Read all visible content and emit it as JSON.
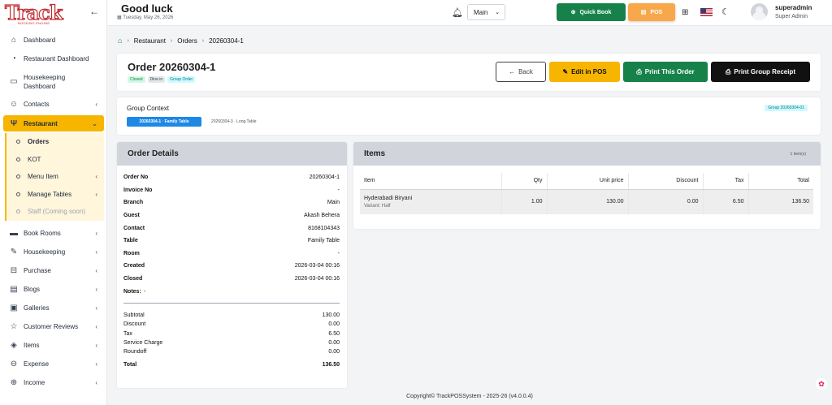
{
  "brand": {
    "name": "Track",
    "tagline": "BOOKING ENGINE"
  },
  "header": {
    "greeting": "Good luck",
    "date": "Tuesday, May 26, 2026",
    "branch": "Main",
    "quick_book": "Quick Book",
    "pos": "POS",
    "user_name": "superadmin",
    "user_role": "Super Admin"
  },
  "sidebar": {
    "items": [
      {
        "label": "Dashboard",
        "icon": "home-icon"
      },
      {
        "label": "Restaurant Dashboard",
        "icon": "dashboard-icon"
      },
      {
        "label": "Housekeeping Dashboard",
        "icon": "housekeeping-icon"
      },
      {
        "label": "Contacts",
        "icon": "contacts-icon"
      },
      {
        "label": "Restaurant",
        "icon": "fork-knife-icon"
      }
    ],
    "restaurant_sub": [
      {
        "label": "Orders"
      },
      {
        "label": "KOT"
      },
      {
        "label": "Menu Item"
      },
      {
        "label": "Manage Tables"
      },
      {
        "label": "Staff (Coming soon)"
      }
    ],
    "items_after": [
      {
        "label": "Book Rooms",
        "icon": "bed-icon"
      },
      {
        "label": "Housekeeping",
        "icon": "broom-icon"
      },
      {
        "label": "Purchase",
        "icon": "cart-icon"
      },
      {
        "label": "Blogs",
        "icon": "blog-icon"
      },
      {
        "label": "Galleries",
        "icon": "gallery-icon"
      },
      {
        "label": "Customer Reviews",
        "icon": "star-icon"
      },
      {
        "label": "Items",
        "icon": "box-icon"
      },
      {
        "label": "Expense",
        "icon": "minus-circle-icon"
      },
      {
        "label": "Income",
        "icon": "plus-circle-icon"
      }
    ]
  },
  "breadcrumb": {
    "items": [
      "Restaurant",
      "Orders",
      "20260304-1"
    ]
  },
  "order": {
    "title": "Order 20260304-1",
    "badges": {
      "status": "Closed",
      "type": "Dine in",
      "group": "Group Order"
    },
    "buttons": {
      "back": "Back",
      "edit": "Edit in POS",
      "print": "Print This Order",
      "receipt": "Print Group Receipt"
    }
  },
  "group_context": {
    "title": "Group Context",
    "active": "20260304-1 · Family Table",
    "other": "20260304-3 · Long Table",
    "group_id": "Group 20260304-01"
  },
  "details": {
    "title": "Order Details",
    "rows": [
      {
        "k": "Order No",
        "v": "20260304-1"
      },
      {
        "k": "Invoice No",
        "v": "-"
      },
      {
        "k": "Branch",
        "v": "Main"
      },
      {
        "k": "Guest",
        "v": "Akash Behera"
      },
      {
        "k": "Contact",
        "v": "8168104343"
      },
      {
        "k": "Table",
        "v": "Family Table"
      },
      {
        "k": "Room",
        "v": "-"
      },
      {
        "k": "Created",
        "v": "2026-03-04 00:16"
      },
      {
        "k": "Closed",
        "v": "2026-03-04 00:16"
      },
      {
        "k": "Notes:",
        "v": "-"
      }
    ],
    "totals": [
      {
        "k": "Subtotal",
        "v": "130.00"
      },
      {
        "k": "Discount",
        "v": "0.00"
      },
      {
        "k": "Tax",
        "v": "6.50"
      },
      {
        "k": "Service Charge",
        "v": "0.00"
      },
      {
        "k": "Roundoff",
        "v": "0.00"
      }
    ],
    "total": {
      "k": "Total",
      "v": "136.50"
    }
  },
  "items": {
    "title": "Items",
    "count": "1 item(s)",
    "columns": [
      "Item",
      "Qty",
      "Unit price",
      "Discount",
      "Tax",
      "Total"
    ],
    "rows": [
      {
        "item": "Hyderabadi Biryani",
        "variant": "Variant: Half",
        "qty": "1.00",
        "unit_price": "130.00",
        "discount": "0.00",
        "tax": "6.50",
        "total": "136.50"
      }
    ]
  },
  "footer": "Copyright© TrackPOSSystem - 2025-26 (v4.0.0.4)",
  "colors": {
    "accent": "#f7b500",
    "green": "#16824a",
    "dark": "#111111",
    "blue": "#1e88e5"
  }
}
